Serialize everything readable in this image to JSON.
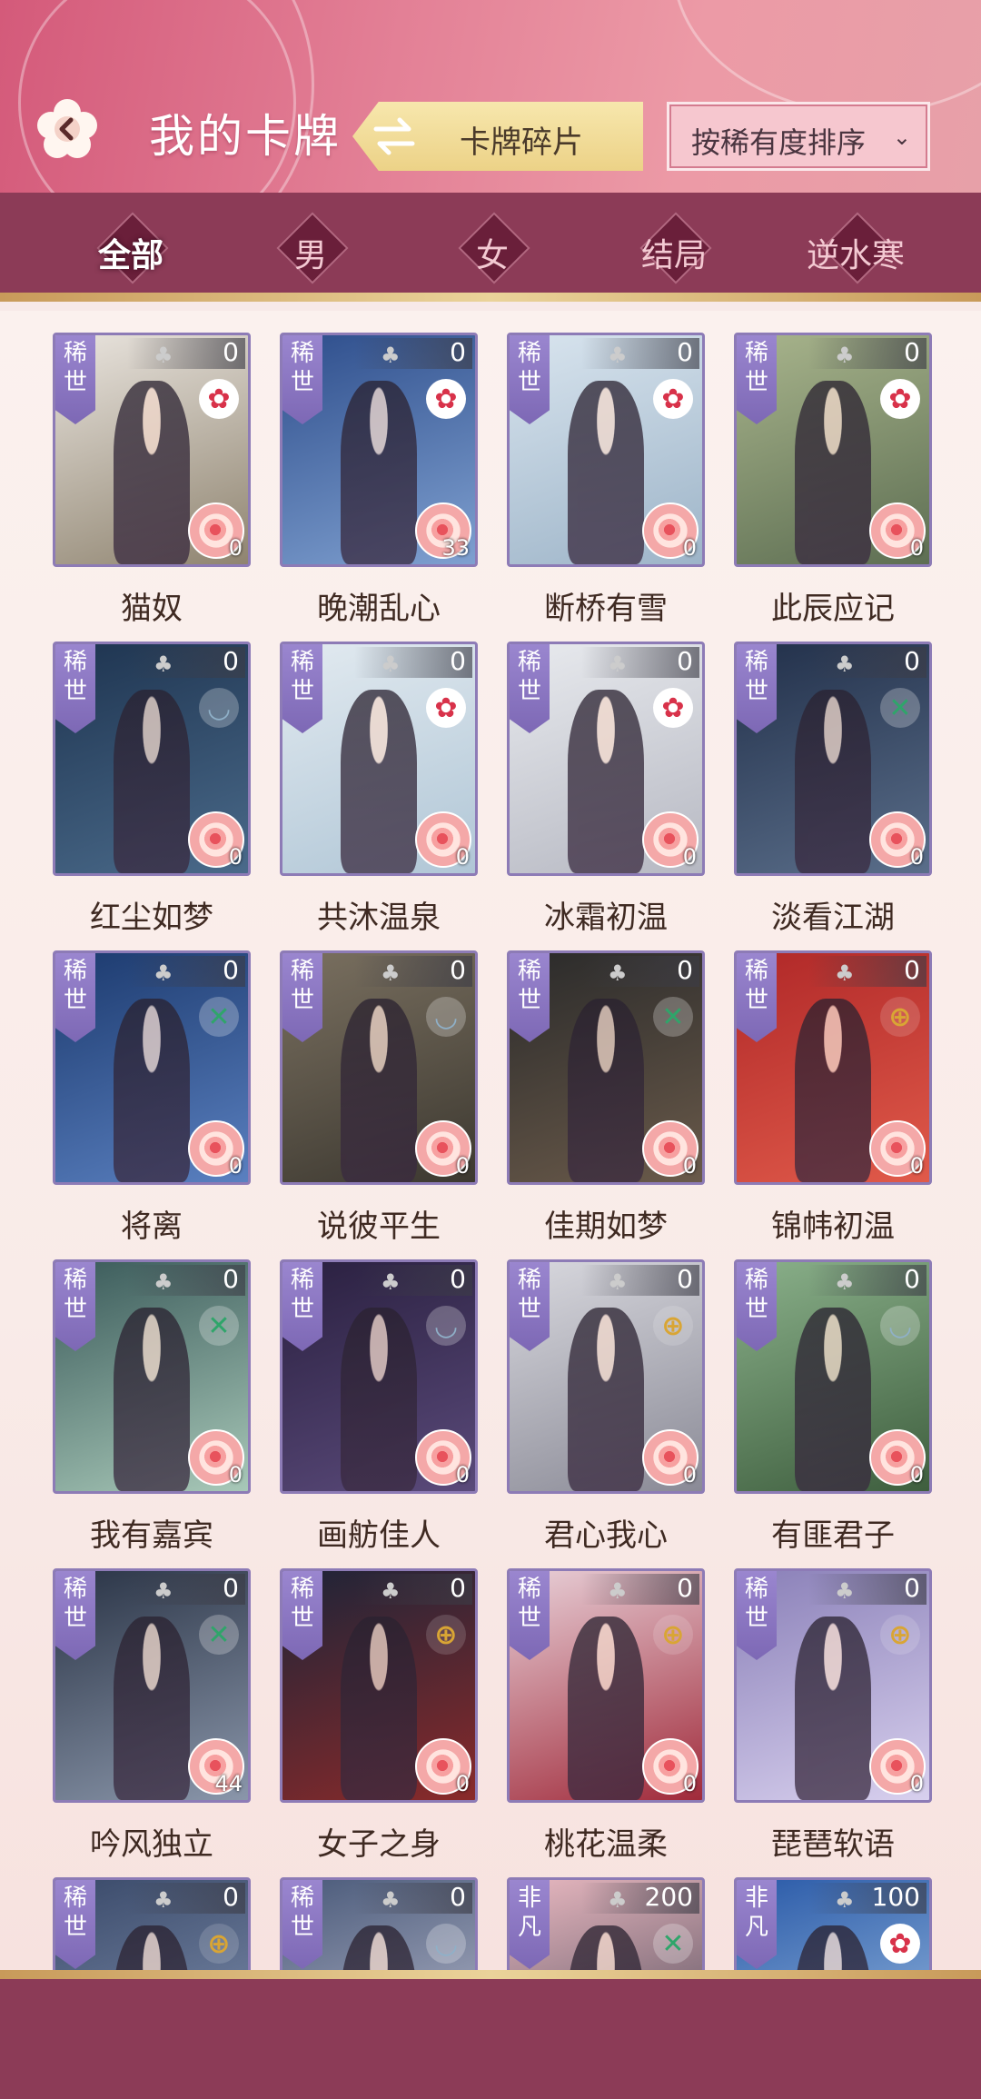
{
  "header": {
    "title": "我的卡牌",
    "fragments_label": "卡牌碎片",
    "sort_label": "按稀有度排序",
    "sort_chevron": "›"
  },
  "filters": [
    {
      "label": "全部",
      "active": true
    },
    {
      "label": "男",
      "active": false
    },
    {
      "label": "女",
      "active": false
    },
    {
      "label": "结局",
      "active": false
    },
    {
      "label": "逆水寒",
      "active": false
    }
  ],
  "elements": {
    "flower": {
      "symbol": "✿",
      "color": "#d8324a",
      "bg": "#ffffff"
    },
    "fan": {
      "symbol": "◡",
      "color": "#8fb0c8",
      "bg": "rgba(255,255,255,0.25)"
    },
    "bow": {
      "symbol": "✕",
      "color": "#2fa56a",
      "bg": "rgba(255,255,255,0.25)"
    },
    "coin": {
      "symbol": "⊕",
      "color": "#d9a534",
      "bg": "rgba(255,255,255,0.15)"
    }
  },
  "cards": [
    {
      "name": "猫奴",
      "rarity": "稀世",
      "count": "0",
      "badge": "0",
      "element": "flower",
      "bg": [
        "#e9e4de",
        "#8f8470"
      ]
    },
    {
      "name": "晚潮乱心",
      "rarity": "稀世",
      "count": "0",
      "badge": "33",
      "element": "flower",
      "bg": [
        "#2e4e8c",
        "#7fa0d0"
      ]
    },
    {
      "name": "断桥有雪",
      "rarity": "稀世",
      "count": "0",
      "badge": "0",
      "element": "flower",
      "bg": [
        "#d8e4ee",
        "#9db4c8"
      ]
    },
    {
      "name": "此辰应记",
      "rarity": "稀世",
      "count": "0",
      "badge": "0",
      "element": "flower",
      "bg": [
        "#a8b48c",
        "#5d6e52"
      ]
    },
    {
      "name": "红尘如梦",
      "rarity": "稀世",
      "count": "0",
      "badge": "0",
      "element": "fan",
      "bg": [
        "#1e3450",
        "#4a6a8a"
      ]
    },
    {
      "name": "共沐温泉",
      "rarity": "稀世",
      "count": "0",
      "badge": "0",
      "element": "flower",
      "bg": [
        "#e2eaf0",
        "#b0c6d6"
      ]
    },
    {
      "name": "冰霜初温",
      "rarity": "稀世",
      "count": "0",
      "badge": "0",
      "element": "flower",
      "bg": [
        "#e8eaee",
        "#b6b8c2"
      ]
    },
    {
      "name": "淡看江湖",
      "rarity": "稀世",
      "count": "0",
      "badge": "0",
      "element": "bow",
      "bg": [
        "#22304a",
        "#5a6e8a"
      ]
    },
    {
      "name": "将离",
      "rarity": "稀世",
      "count": "0",
      "badge": "0",
      "element": "bow",
      "bg": [
        "#1c3a6e",
        "#5a80c0"
      ]
    },
    {
      "name": "说彼平生",
      "rarity": "稀世",
      "count": "0",
      "badge": "0",
      "element": "fan",
      "bg": [
        "#7a7060",
        "#3c3830"
      ]
    },
    {
      "name": "佳期如梦",
      "rarity": "稀世",
      "count": "0",
      "badge": "0",
      "element": "bow",
      "bg": [
        "#2a2a2a",
        "#6a5a4a"
      ]
    },
    {
      "name": "锦帏初温",
      "rarity": "稀世",
      "count": "0",
      "badge": "0",
      "element": "coin",
      "bg": [
        "#b02828",
        "#e05a4a"
      ]
    },
    {
      "name": "我有嘉宾",
      "rarity": "稀世",
      "count": "0",
      "badge": "0",
      "element": "bow",
      "bg": [
        "#3a5a5a",
        "#a8c8b8"
      ]
    },
    {
      "name": "画舫佳人",
      "rarity": "稀世",
      "count": "0",
      "badge": "0",
      "element": "fan",
      "bg": [
        "#2a2040",
        "#5a4a7a"
      ]
    },
    {
      "name": "君心我心",
      "rarity": "稀世",
      "count": "0",
      "badge": "0",
      "element": "coin",
      "bg": [
        "#d8d8de",
        "#8a8a96"
      ]
    },
    {
      "name": "有匪君子",
      "rarity": "稀世",
      "count": "0",
      "badge": "0",
      "element": "fan",
      "bg": [
        "#8ab08a",
        "#3e5e3e"
      ]
    },
    {
      "name": "吟风独立",
      "rarity": "稀世",
      "count": "0",
      "badge": "44",
      "element": "bow",
      "bg": [
        "#2a3446",
        "#8a96aa"
      ]
    },
    {
      "name": "女子之身",
      "rarity": "稀世",
      "count": "0",
      "badge": "0",
      "element": "coin",
      "bg": [
        "#1e2438",
        "#8a2a2a"
      ]
    },
    {
      "name": "桃花温柔",
      "rarity": "稀世",
      "count": "0",
      "badge": "0",
      "element": "coin",
      "bg": [
        "#e8d0d8",
        "#a02a3a"
      ]
    },
    {
      "name": "琵琶软语",
      "rarity": "稀世",
      "count": "0",
      "badge": "0",
      "element": "coin",
      "bg": [
        "#8a80b8",
        "#d8d0ee"
      ]
    },
    {
      "name": "",
      "rarity": "稀世",
      "count": "0",
      "badge": "",
      "element": "coin",
      "bg": [
        "#3a4a6a",
        "#8a9ab8"
      ]
    },
    {
      "name": "",
      "rarity": "稀世",
      "count": "0",
      "badge": "",
      "element": "fan",
      "bg": [
        "#4a5a7a",
        "#c8c8d8"
      ]
    },
    {
      "name": "",
      "rarity": "非凡",
      "count": "200",
      "badge": "",
      "element": "bow",
      "bg": [
        "#e8b8c0",
        "#3a3a4a"
      ]
    },
    {
      "name": "",
      "rarity": "非凡",
      "count": "100",
      "badge": "",
      "element": "flower",
      "bg": [
        "#2a5aa8",
        "#a8c8e8"
      ]
    }
  ]
}
